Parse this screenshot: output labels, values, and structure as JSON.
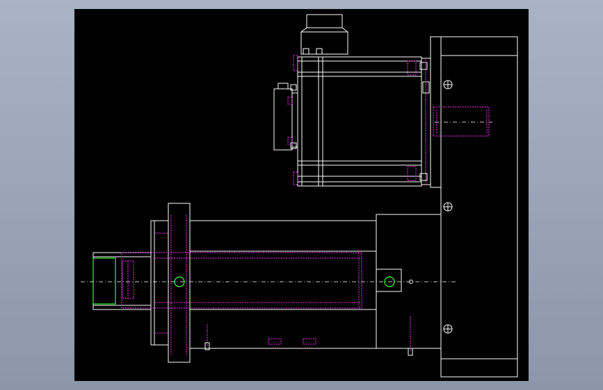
{
  "viewer": {
    "background_top": "#a9b3c6",
    "background_bottom": "#8c96aa"
  },
  "drawing": {
    "paper_color": "#000000",
    "line_color": "#ffffff",
    "hidden_line_color": "#ff33ff",
    "highlight_color": "#33ff33",
    "center_line_color": "#ffffff",
    "views": [
      {
        "name": "motor-top-view"
      },
      {
        "name": "actuator-side-view"
      },
      {
        "name": "mounting-plate"
      }
    ],
    "symbols": [
      {
        "name": "bolt-symbol-top",
        "icon": "circle-cross-icon"
      },
      {
        "name": "bolt-symbol-middle",
        "icon": "circle-cross-icon"
      },
      {
        "name": "bolt-symbol-bottom",
        "icon": "circle-cross-icon"
      }
    ]
  }
}
